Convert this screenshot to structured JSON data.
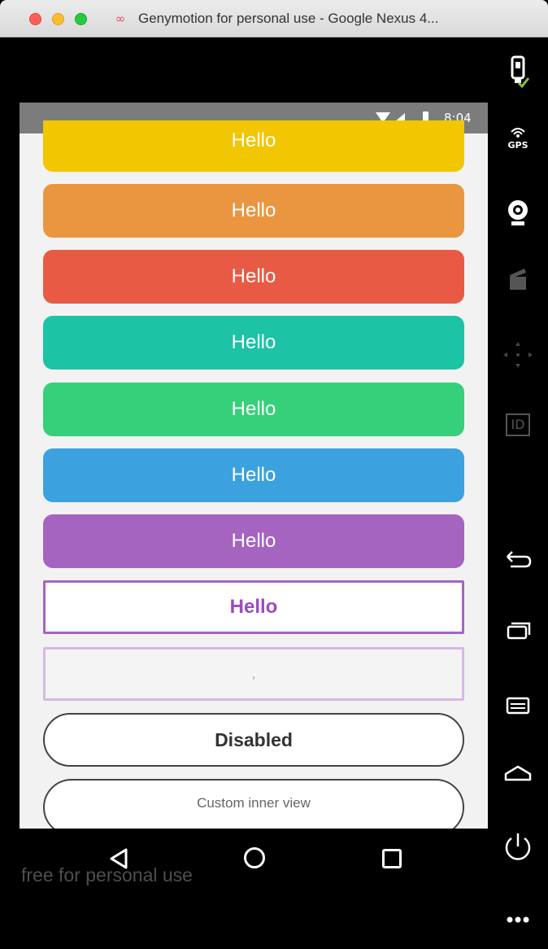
{
  "window": {
    "title": "Genymotion for personal use - Google Nexus 4..."
  },
  "status_bar": {
    "time": "8:04"
  },
  "buttons": [
    {
      "label": "Hello",
      "color": "#f2c600"
    },
    {
      "label": "Hello",
      "color": "#ea9641"
    },
    {
      "label": "Hello",
      "color": "#e85a44"
    },
    {
      "label": "Hello",
      "color": "#1cc3a5"
    },
    {
      "label": "Hello",
      "color": "#36d07a"
    },
    {
      "label": "Hello",
      "color": "#3ca1df"
    },
    {
      "label": "Hello",
      "color": "#a464c0"
    },
    {
      "label": "Hello",
      "color": "#a464c0"
    },
    {
      "label": ","
    },
    {
      "label": "Disabled"
    },
    {
      "label": "Custom inner view"
    }
  ],
  "watermark": "free for personal use",
  "sidebar": {
    "gps_label": "GPS",
    "id_label": "ID",
    "icons": [
      "battery-icon",
      "gps-icon",
      "webcam-icon",
      "clapper-icon",
      "dpad-icon",
      "id-icon",
      "back-icon",
      "recent-apps-icon",
      "menu-icon",
      "home-icon",
      "power-icon",
      "more-icon"
    ]
  },
  "nav_icons": [
    "nav-back-icon",
    "nav-home-icon",
    "nav-recent-icon"
  ]
}
